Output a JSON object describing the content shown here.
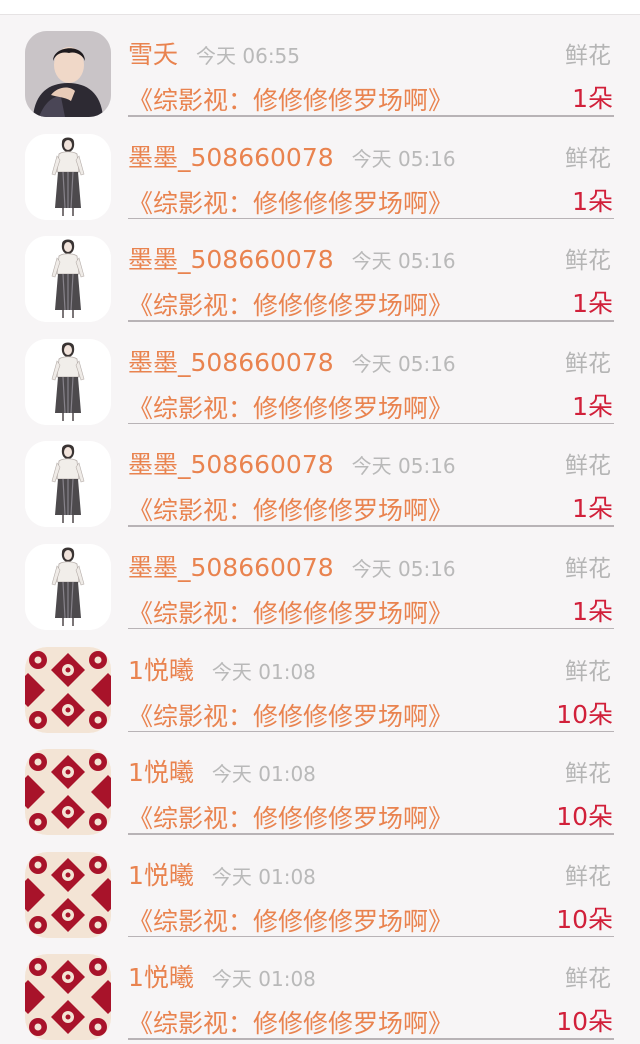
{
  "colors": {
    "name": "#e9834f",
    "time": "#b9b9b9",
    "count": "#d1203a",
    "background": "#f7f5f6"
  },
  "rows": [
    {
      "avatar": "portrait-man-avatar",
      "name": "雪夭",
      "time": "今天 06:55",
      "gift": "鲜花",
      "work": "《综影视：修修修修罗场啊》",
      "count": "1朵"
    },
    {
      "avatar": "sketch-woman-avatar",
      "name": "墨墨_508660078",
      "time": "今天 05:16",
      "gift": "鲜花",
      "work": "《综影视：修修修修罗场啊》",
      "count": "1朵"
    },
    {
      "avatar": "sketch-woman-avatar",
      "name": "墨墨_508660078",
      "time": "今天 05:16",
      "gift": "鲜花",
      "work": "《综影视：修修修修罗场啊》",
      "count": "1朵"
    },
    {
      "avatar": "sketch-woman-avatar",
      "name": "墨墨_508660078",
      "time": "今天 05:16",
      "gift": "鲜花",
      "work": "《综影视：修修修修罗场啊》",
      "count": "1朵"
    },
    {
      "avatar": "sketch-woman-avatar",
      "name": "墨墨_508660078",
      "time": "今天 05:16",
      "gift": "鲜花",
      "work": "《综影视：修修修修罗场啊》",
      "count": "1朵"
    },
    {
      "avatar": "sketch-woman-avatar",
      "name": "墨墨_508660078",
      "time": "今天 05:16",
      "gift": "鲜花",
      "work": "《综影视：修修修修罗场啊》",
      "count": "1朵"
    },
    {
      "avatar": "red-pattern-avatar",
      "name": "1悦曦",
      "time": "今天 01:08",
      "gift": "鲜花",
      "work": "《综影视：修修修修罗场啊》",
      "count": "10朵"
    },
    {
      "avatar": "red-pattern-avatar",
      "name": "1悦曦",
      "time": "今天 01:08",
      "gift": "鲜花",
      "work": "《综影视：修修修修罗场啊》",
      "count": "10朵"
    },
    {
      "avatar": "red-pattern-avatar",
      "name": "1悦曦",
      "time": "今天 01:08",
      "gift": "鲜花",
      "work": "《综影视：修修修修罗场啊》",
      "count": "10朵"
    },
    {
      "avatar": "red-pattern-avatar",
      "name": "1悦曦",
      "time": "今天 01:08",
      "gift": "鲜花",
      "work": "《综影视：修修修修罗场啊》",
      "count": "10朵"
    }
  ]
}
